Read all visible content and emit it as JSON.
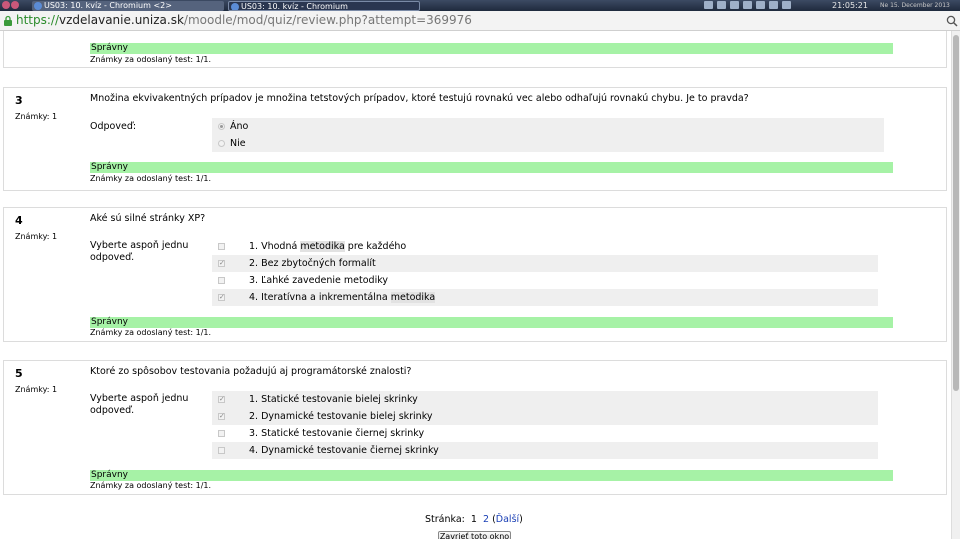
{
  "taskbar": {
    "windows": [
      {
        "title": "US03: 10. kvíz - Chromium <2>"
      },
      {
        "title": "US03: 10. kvíz - Chromium"
      }
    ],
    "clock": "21:05:21",
    "date": "Ne 15. December 2013"
  },
  "urlbar": {
    "scheme": "https://",
    "host": "vzdelavanie.uniza.sk",
    "path": "/moodle/mod/quiz/review.php?attempt=369976"
  },
  "question_top": {
    "status": "Správny",
    "feedback": "Známky za odoslaný test: 1/1."
  },
  "questions": [
    {
      "number": "3",
      "marks": "Známky: 1",
      "text": "Množina ekvivakentných prípadov je množina tetstových prípadov, ktoré testujú rovnakú vec alebo odhaľujú rovnakú chybu. Je to pravda?",
      "answer_label": "Odpoveď:",
      "options": [
        {
          "label": "Áno",
          "selected": true
        },
        {
          "label": "Nie",
          "selected": false
        }
      ],
      "status": "Správny",
      "feedback": "Známky za odoslaný test: 1/1."
    },
    {
      "number": "4",
      "marks": "Známky: 1",
      "text": "Aké sú silné stránky XP?",
      "answer_label": "Vyberte aspoň jednu odpoveď.",
      "options": [
        {
          "pre": "1. Vhodná ",
          "hl": "metodika",
          "post": " pre každého",
          "selected": false
        },
        {
          "pre": "2. Bez zbytočných formalít",
          "hl": "",
          "post": "",
          "selected": true
        },
        {
          "pre": "3. Ľahké zavedenie metodiky",
          "hl": "",
          "post": "",
          "selected": false
        },
        {
          "pre": "4. Iteratívna a inkrementálna ",
          "hl": "metodika",
          "post": "",
          "selected": true
        }
      ],
      "status": "Správny",
      "feedback": "Známky za odoslaný test: 1/1."
    },
    {
      "number": "5",
      "marks": "Známky: 1",
      "text": "Ktoré zo spôsobov testovania požadujú aj programátorské znalosti?",
      "answer_label": "Vyberte aspoň jednu odpoveď.",
      "options": [
        {
          "label": "1. Statické testovanie bielej skrinky",
          "selected": true
        },
        {
          "label": "2. Dynamické testovanie bielej skrinky",
          "selected": true
        },
        {
          "label": "3. Statické testovanie čiernej skrinky",
          "selected": false
        },
        {
          "label": "4. Dynamické testovanie čiernej skrinky",
          "selected": false
        }
      ],
      "status": "Správny",
      "feedback": "Známky za odoslaný test: 1/1."
    }
  ],
  "pager": {
    "label": "Stránka:",
    "current": "1",
    "next_page": "2",
    "next_label": "Ďalší"
  },
  "close_button": "Zavrieť toto okno"
}
